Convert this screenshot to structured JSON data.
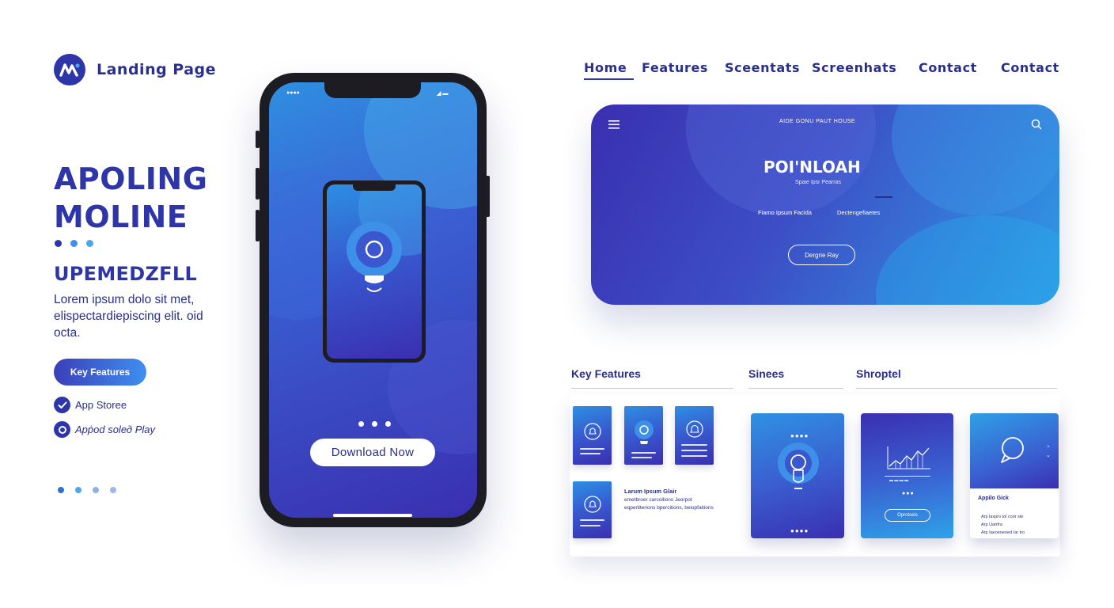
{
  "brand": {
    "name": "Landing Page",
    "logo_icon": "brand-m-logo-icon"
  },
  "nav": {
    "items": [
      {
        "label": "Home",
        "active": true
      },
      {
        "label": "Features",
        "active": false
      },
      {
        "label": "Sceentats",
        "active": false
      },
      {
        "label": "Screenhats",
        "active": false
      },
      {
        "label": "Contact",
        "active": false
      },
      {
        "label": "Contact",
        "active": false
      }
    ]
  },
  "hero": {
    "title_line1": "APOLING",
    "title_line2": "MOLINE",
    "subtitle": "UPEMEDZFLL",
    "description": "Lorem ipsum dolo sit met, elispectardiepiscing elit. oid octa.",
    "cta_label": "Key Features",
    "stores": [
      {
        "label": "App Storee",
        "icon": "check-icon"
      },
      {
        "label": "Apṗod solед Play",
        "icon": "circle-icon"
      }
    ]
  },
  "phone": {
    "download_label": "Download Now",
    "icon": "lightbulb-icon"
  },
  "web_card": {
    "nav_text": "AIDE GONU PAUT HOUSE",
    "title": "POI'NLOAH",
    "subtitle": "Spaie Ipsr Pearras",
    "col1": "Fiamo Ipsum Facida",
    "col2": "Dectengefiaetes",
    "button_label": "Dergrie Ray"
  },
  "sections": {
    "key_features": "Key Features",
    "sinees": "Sinees",
    "shroptel": "Shroptel"
  },
  "lower": {
    "thumb_text_title": "Larum Ipsum Glair",
    "thumb_text_body": "emetbroer carcollions Jeorpot eqpertiterions bpercitions, beiopfaitions",
    "card2_button": "Oprotsels",
    "card3_title": "Appilo Gick",
    "card3_line1": "Arp laxpro tol coor ste",
    "card3_line2": "Arp Uatrfra",
    "card3_line3": "Arp Iaeoeneoed Iar tro"
  },
  "colors": {
    "brand_dark": "#2e35a8",
    "text_dark": "#2a2f8c",
    "accent_blue": "#3f8ff0",
    "accent_light": "#4aa8e8"
  }
}
